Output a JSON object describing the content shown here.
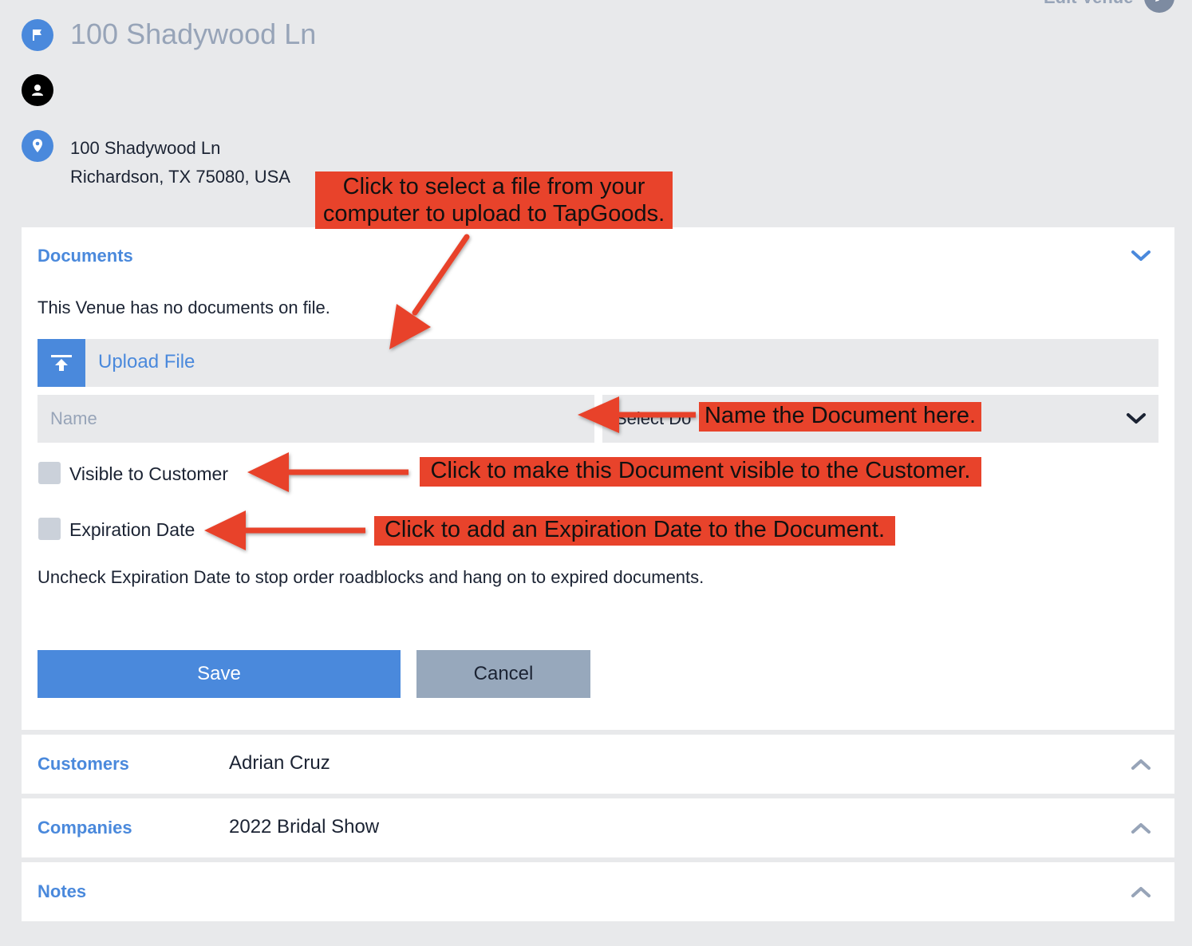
{
  "header": {
    "venue_title": "100 Shadywood Ln",
    "edit_link": "Edit Venue",
    "address_line1": "100 Shadywood Ln",
    "address_line2": "Richardson, TX 75080, USA"
  },
  "documents": {
    "title": "Documents",
    "empty_message": "This Venue has no documents on file.",
    "upload_label": "Upload File",
    "name_placeholder": "Name",
    "name_value": "",
    "select_type_text": "Select Do",
    "visible_label": "Visible to Customer",
    "visible_checked": false,
    "expiration_label": "Expiration Date",
    "expiration_checked": false,
    "hint": "Uncheck Expiration Date to stop order roadblocks and hang on to expired documents.",
    "save_label": "Save",
    "cancel_label": "Cancel"
  },
  "sections": {
    "customers": {
      "title": "Customers",
      "value": "Adrian Cruz"
    },
    "companies": {
      "title": "Companies",
      "value": "2022 Bridal Show"
    },
    "notes": {
      "title": "Notes",
      "value": ""
    }
  },
  "annotations": {
    "upload_line1": "Click to select a file from your",
    "upload_line2": "computer to upload to TapGoods.",
    "name": "Name the Document here.",
    "visible": "Click to make this Document visible to the Customer.",
    "expiration": "Click to add an Expiration Date to the Document."
  },
  "colors": {
    "background": "#e8e9eb",
    "accent": "#4a89dc",
    "muted": "#97a4b8",
    "annotation": "#e8432b"
  },
  "icons": [
    "flag-icon",
    "user-icon",
    "location-pin-icon",
    "upload-icon",
    "chevron-down-icon",
    "chevron-up-icon",
    "pencil-icon"
  ]
}
